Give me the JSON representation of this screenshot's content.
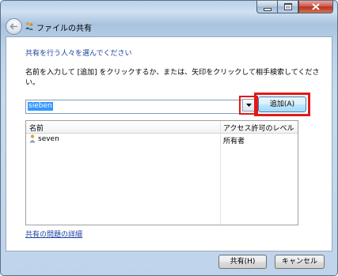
{
  "window": {
    "title": "ファイルの共有",
    "controls": {
      "minimize": "minimize-icon",
      "maximize": "maximize-icon",
      "close": "close-icon"
    }
  },
  "header": {
    "heading": "共有を行う人々を選んでください"
  },
  "main": {
    "instruction": "名前を入力して [追加] をクリックするか、または、矢印をクリックして相手検索してください。",
    "name_input": {
      "value": "sieben"
    },
    "add_button": "追加(A)",
    "list": {
      "columns": [
        "名前",
        "アクセス許可のレベル"
      ],
      "rows": [
        {
          "name": "seven",
          "level": "所有者",
          "icon": "user-icon"
        }
      ]
    },
    "help_link": "共有の問題の詳細"
  },
  "footer": {
    "share_button": "共有(H)",
    "cancel_button": "キャンセル"
  },
  "colors": {
    "highlight_box": "#e01a1a",
    "link": "#1c3fa0",
    "selection": "#3399ff"
  }
}
